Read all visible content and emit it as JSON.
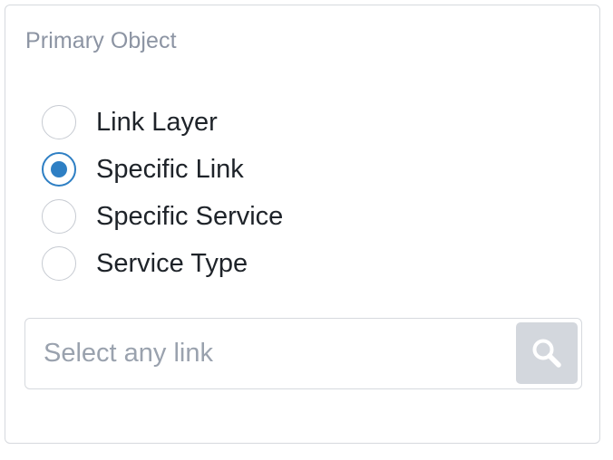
{
  "panel": {
    "title": "Primary Object"
  },
  "primary_object_options": [
    {
      "label": "Link Layer",
      "checked": false
    },
    {
      "label": "Specific Link",
      "checked": true
    },
    {
      "label": "Specific Service",
      "checked": false
    },
    {
      "label": "Service Type",
      "checked": false
    }
  ],
  "search": {
    "placeholder": "Select any link",
    "value": "",
    "button_icon": "search-icon"
  },
  "colors": {
    "accent": "#2e7fc4",
    "border": "#d6d9de",
    "muted_text": "#8c94a3",
    "button_bg": "#d3d7dd"
  }
}
